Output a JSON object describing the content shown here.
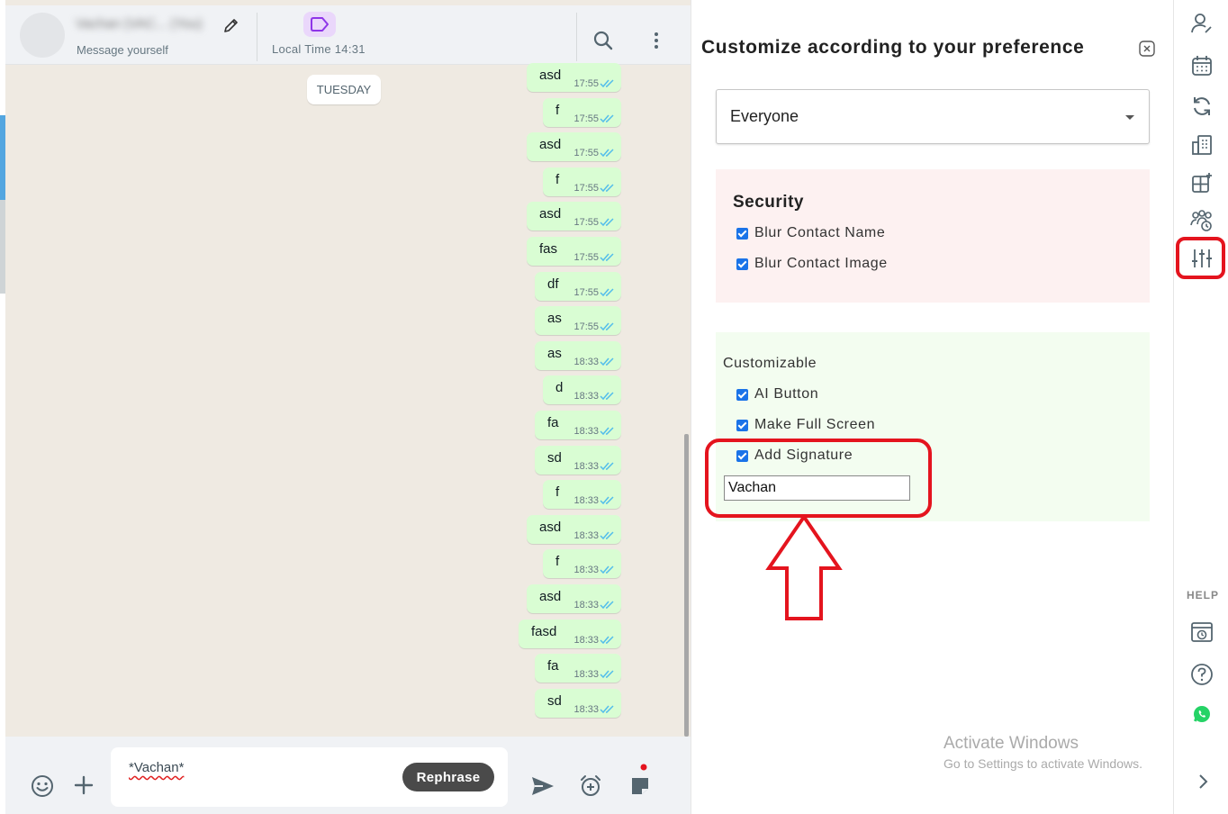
{
  "chat": {
    "header": {
      "contact_name": "Vachan (VAC... (You)",
      "status": "Message yourself",
      "local_time": "Local Time 14:31"
    },
    "day_label": "TUESDAY",
    "messages": [
      {
        "text": "asd",
        "time": "17:55"
      },
      {
        "text": "f",
        "time": "17:55"
      },
      {
        "text": "asd",
        "time": "17:55"
      },
      {
        "text": "f",
        "time": "17:55"
      },
      {
        "text": "asd",
        "time": "17:55"
      },
      {
        "text": "fas",
        "time": "17:55"
      },
      {
        "text": "df",
        "time": "17:55"
      },
      {
        "text": "as",
        "time": "17:55"
      },
      {
        "text": "as",
        "time": "18:33"
      },
      {
        "text": "d",
        "time": "18:33"
      },
      {
        "text": "fa",
        "time": "18:33"
      },
      {
        "text": "sd",
        "time": "18:33"
      },
      {
        "text": "f",
        "time": "18:33"
      },
      {
        "text": "asd",
        "time": "18:33"
      },
      {
        "text": "f",
        "time": "18:33"
      },
      {
        "text": "asd",
        "time": "18:33"
      },
      {
        "text": "fasd",
        "time": "18:33"
      },
      {
        "text": "fa",
        "time": "18:33"
      },
      {
        "text": "sd",
        "time": "18:33"
      }
    ],
    "composer": {
      "text": "*Vachan*",
      "rephrase_label": "Rephrase"
    }
  },
  "panel": {
    "title": "Customize according to your preference",
    "audience_select": "Everyone",
    "security": {
      "title": "Security",
      "options": [
        "Blur Contact Name",
        "Blur Contact Image"
      ]
    },
    "customizable": {
      "title": "Customizable",
      "options": [
        "AI Button",
        "Make Full Screen",
        "Add Signature"
      ],
      "signature_value": "Vachan"
    }
  },
  "rail": {
    "help_label": "HELP"
  },
  "watermark": {
    "title": "Activate Windows",
    "subtitle": "Go to Settings to activate Windows."
  },
  "colors": {
    "bubble": "#d9fdd3",
    "chat_bg": "#efeae2",
    "highlight": "#e4141e",
    "checkbox": "#1a73e8",
    "security_bg": "#fdf1f1",
    "custom_bg": "#f3fdf0"
  }
}
